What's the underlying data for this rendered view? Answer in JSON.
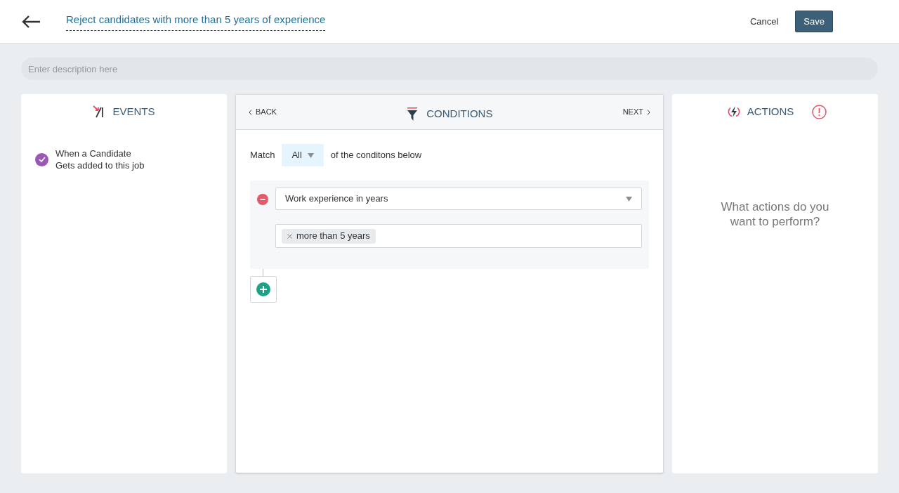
{
  "header": {
    "title": "Reject candidates with more than 5 years of experience",
    "buttons": [
      {
        "label": "Cancel",
        "kind": "link"
      },
      {
        "label": "Save",
        "kind": "primary"
      }
    ]
  },
  "description": {
    "placeholder": "Enter description here"
  },
  "events": {
    "title": "EVENTS",
    "items": [
      {
        "lines": [
          "When a Candidate",
          "Gets added to this job"
        ],
        "checked": true
      }
    ]
  },
  "conditions": {
    "back": "BACK",
    "title": "CONDITIONS",
    "next": "NEXT",
    "match_label": "Match",
    "match_value": "All",
    "match_suffix": "of the conditons below",
    "rules": [
      {
        "field": "Work experience in years",
        "tags": [
          "more than 5 years"
        ]
      }
    ]
  },
  "actions": {
    "title": "ACTIONS",
    "warning": true,
    "empty_text": "What actions do you want to perform?"
  }
}
